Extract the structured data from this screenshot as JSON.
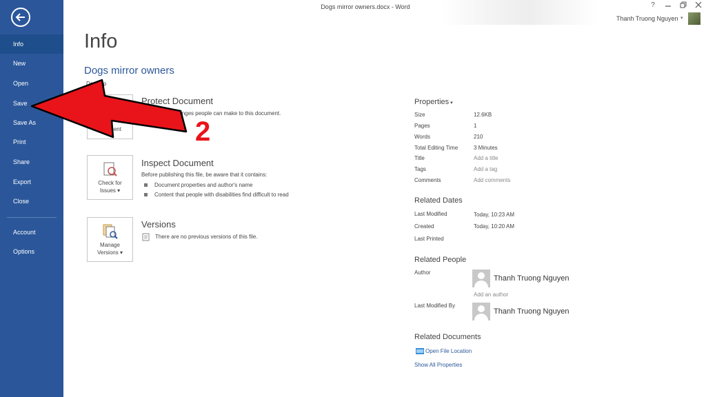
{
  "titlebar": {
    "title": "Dogs mirror owners.docx - Word",
    "help": "?"
  },
  "user": {
    "name": "Thanh Truong Nguyen"
  },
  "sidebar": {
    "items": [
      {
        "label": "Info"
      },
      {
        "label": "New"
      },
      {
        "label": "Open"
      },
      {
        "label": "Save"
      },
      {
        "label": "Save As"
      },
      {
        "label": "Print"
      },
      {
        "label": "Share"
      },
      {
        "label": "Export"
      },
      {
        "label": "Close"
      },
      {
        "label": "Account"
      },
      {
        "label": "Options"
      }
    ]
  },
  "main": {
    "title": "Info",
    "doc_title": "Dogs mirror owners",
    "location": "Desktop"
  },
  "protect": {
    "title": "Protect Document",
    "desc": "...at types of changes people can make to this document.",
    "button_label": "...cument"
  },
  "inspect": {
    "title": "Inspect Document",
    "desc": "Before publishing this file, be aware that it contains:",
    "bullets": [
      "Document properties and author's name",
      "Content that people with disabilities find difficult to read"
    ],
    "button_label_1": "Check for",
    "button_label_2": "Issues"
  },
  "versions": {
    "title": "Versions",
    "desc": "There are no previous versions of this file.",
    "button_label_1": "Manage",
    "button_label_2": "Versions"
  },
  "properties": {
    "header": "Properties",
    "rows": [
      {
        "label": "Size",
        "value": "12.6KB"
      },
      {
        "label": "Pages",
        "value": "1"
      },
      {
        "label": "Words",
        "value": "210"
      },
      {
        "label": "Total Editing Time",
        "value": "3 Minutes"
      },
      {
        "label": "Title",
        "value": "Add a title"
      },
      {
        "label": "Tags",
        "value": "Add a tag"
      },
      {
        "label": "Comments",
        "value": "Add comments"
      }
    ]
  },
  "related_dates": {
    "header": "Related Dates",
    "rows": [
      {
        "label": "Last Modified",
        "value": "Today, 10:23 AM"
      },
      {
        "label": "Created",
        "value": "Today, 10:20 AM"
      },
      {
        "label": "Last Printed",
        "value": ""
      }
    ]
  },
  "related_people": {
    "header": "Related People",
    "author_label": "Author",
    "author_name": "Thanh Truong Nguyen",
    "add_author": "Add an author",
    "modified_label": "Last Modified By",
    "modified_name": "Thanh Truong Nguyen"
  },
  "related_documents": {
    "header": "Related Documents",
    "open_location": "Open File Location",
    "show_all": "Show All Properties"
  },
  "annotation": {
    "step": "2",
    "color": "#e8141a"
  }
}
